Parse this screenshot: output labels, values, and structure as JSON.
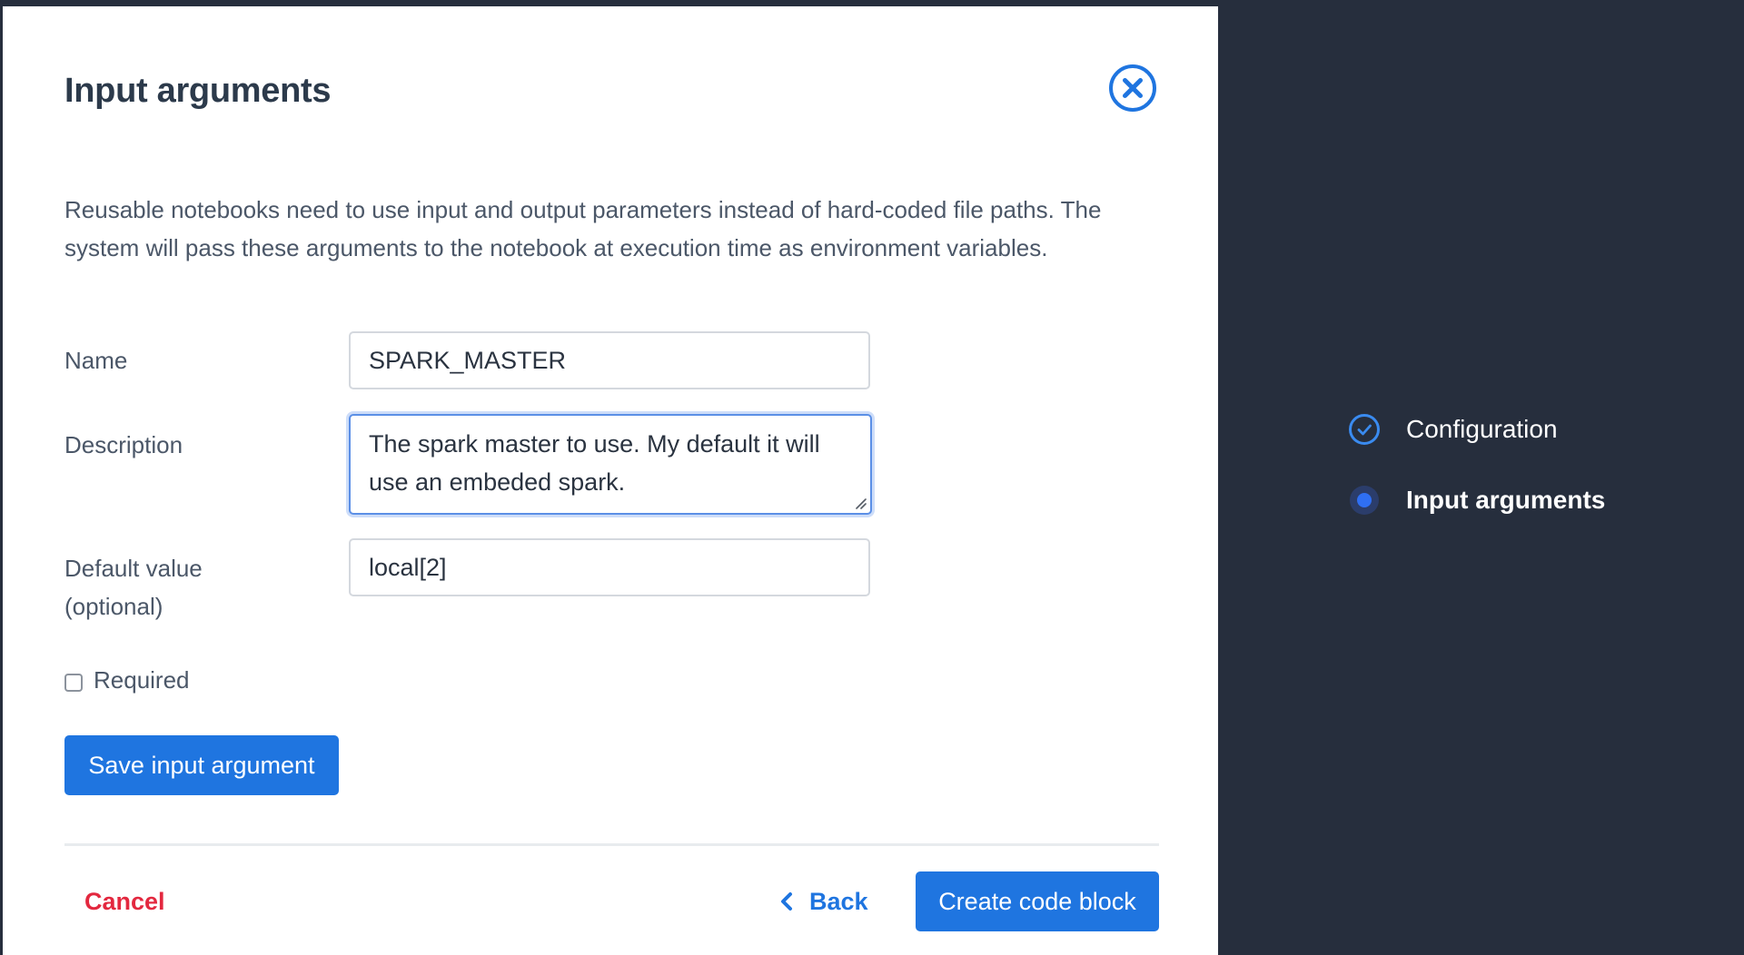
{
  "modal": {
    "title": "Input arguments",
    "description": "Reusable notebooks need to use input and output parameters instead of hard-coded file paths. The system will pass these arguments to the notebook at execution time as environment variables.",
    "fields": {
      "name": {
        "label": "Name",
        "value": "SPARK_MASTER"
      },
      "description": {
        "label": "Description",
        "value": "The spark master to use. My default it will use an embeded spark."
      },
      "default_value": {
        "label": "Default value (optional)",
        "value": "local[2]"
      },
      "required": {
        "label": "Required",
        "checked": false
      }
    },
    "save_button": "Save input argument",
    "footer": {
      "cancel": "Cancel",
      "back": "Back",
      "create": "Create code block"
    }
  },
  "steps": [
    {
      "label": "Configuration",
      "status": "complete",
      "icon": "check-circle-icon"
    },
    {
      "label": "Input arguments",
      "status": "active",
      "icon": "active-dot-icon"
    }
  ],
  "colors": {
    "accent": "#1f75e0",
    "danger": "#e3283f",
    "sidebar": "#262e3d",
    "title": "#2c3a4b",
    "body_text": "#4b5768"
  }
}
